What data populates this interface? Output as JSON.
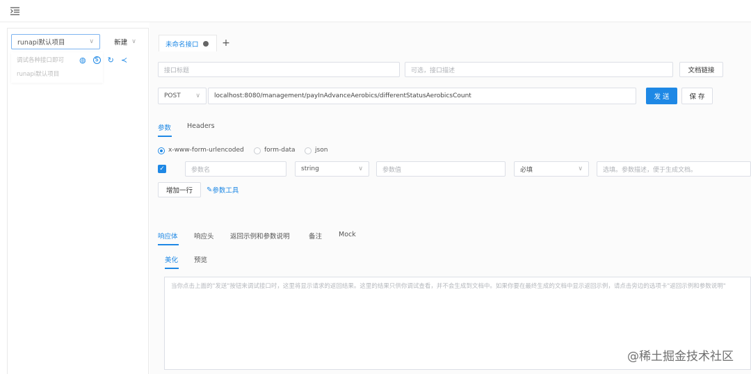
{
  "topbar": {
    "menu_icon": "indent-menu-icon"
  },
  "sidebar": {
    "project_select": "runapi默认项目",
    "new_button": "新建",
    "dropdown_items": [
      "调试各种接口即可",
      "runapi默认项目"
    ],
    "action_icons": [
      "globe-icon",
      "dollar-circle-icon",
      "refresh-icon",
      "share-icon"
    ]
  },
  "tabs": {
    "active_tab": "未命名接口",
    "add": "+"
  },
  "api": {
    "title_placeholder": "接口标题",
    "desc_placeholder": "可选，接口描述",
    "doc_link_button": "文档链接",
    "method": "POST",
    "url": "localhost:8080/management/payInAdvanceAerobics/differentStatusAerobicsCount",
    "send_button": "发 送",
    "save_button": "保 存"
  },
  "request": {
    "tabs": [
      "参数",
      "Headers"
    ],
    "body_types": [
      "x-www-form-urlencoded",
      "form-data",
      "json"
    ],
    "selected_body_type": "x-www-form-urlencoded",
    "param_row": {
      "name_placeholder": "参数名",
      "type": "string",
      "value_placeholder": "参数值",
      "required": "必填",
      "desc_placeholder": "选填。参数描述，便于生成文档。"
    },
    "add_row_button": "增加一行",
    "param_tool": "参数工具"
  },
  "response": {
    "tabs": [
      "响应体",
      "响应头",
      "返回示例和参数说明",
      "备注",
      "Mock"
    ],
    "sub_tabs": [
      "美化",
      "预览"
    ],
    "placeholder": "当你点击上面的\"发送\"按钮来调试接口时，这里将显示请求的返回结果。这里的结果只供你调试查看，并不会生成到文档中。如果你要在最终生成的文档中显示返回示例，请点击旁边的选项卡\"返回示例和参数说明\""
  },
  "watermark": "@稀土掘金技术社区",
  "colors": {
    "primary": "#1e88e5",
    "border": "#dcdfe6"
  }
}
